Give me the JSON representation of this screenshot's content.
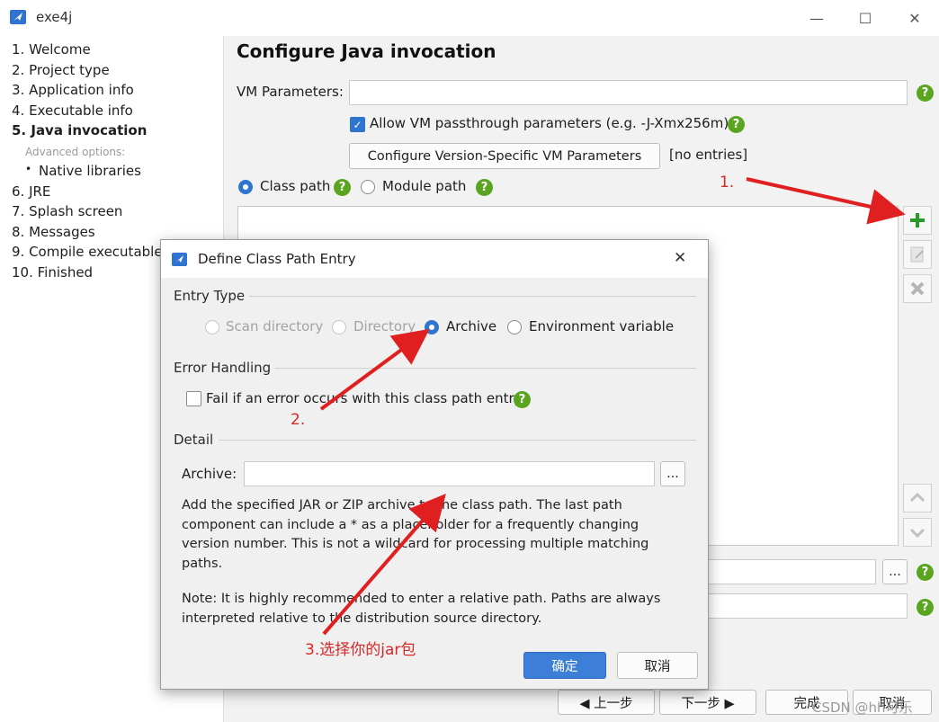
{
  "window": {
    "title": "exe4j",
    "minimize": "—",
    "maximize": "☐",
    "close": "✕"
  },
  "sidebar": {
    "items": [
      {
        "label": "1. Welcome"
      },
      {
        "label": "2. Project type"
      },
      {
        "label": "3. Application info"
      },
      {
        "label": "4. Executable info"
      },
      {
        "label": "5. Java invocation"
      },
      {
        "label": "Advanced options:"
      },
      {
        "label": "Native libraries"
      },
      {
        "label": "6. JRE"
      },
      {
        "label": "7. Splash screen"
      },
      {
        "label": "8. Messages"
      },
      {
        "label": "9. Compile executable"
      },
      {
        "label": "10. Finished"
      }
    ],
    "bullet": "•"
  },
  "main": {
    "title": "Configure Java invocation",
    "vm_params_label": "VM Parameters:",
    "vm_params_value": "",
    "passthrough_label": "Allow VM passthrough parameters (e.g. -J-Xmx256m)",
    "passthrough_checked": true,
    "configure_version_button": "Configure Version-Specific VM Parameters",
    "no_entries": "[no entries]",
    "class_path_label": "Class path",
    "module_path_label": "Module path",
    "help_glyph": "?",
    "ellipsis": "...",
    "nav": {
      "back": "◀  上一步",
      "next": "下一步  ▶",
      "finish": "完成",
      "cancel": "取消"
    }
  },
  "dialog": {
    "title": "Define Class Path Entry",
    "close": "✕",
    "entry_type_label": "Entry Type",
    "entry_types": [
      {
        "label": "Scan directory",
        "enabled": false,
        "selected": false
      },
      {
        "label": "Directory",
        "enabled": false,
        "selected": false
      },
      {
        "label": "Archive",
        "enabled": true,
        "selected": true
      },
      {
        "label": "Environment variable",
        "enabled": true,
        "selected": false
      }
    ],
    "error_handling_label": "Error Handling",
    "fail_label": "Fail if an error occurs with this class path entry",
    "fail_checked": false,
    "detail_label": "Detail",
    "archive_label": "Archive:",
    "archive_value": "",
    "browse": "...",
    "description": [
      "Add the specified JAR or ZIP archive to the class path. The last path",
      "component can include a * as a placeholder for a frequently changing",
      "version number. This is not a wildcard for processing multiple matching",
      "paths."
    ],
    "note": [
      "Note: It is highly recommended to enter a relative path. Paths are always",
      "interpreted relative to the distribution source directory."
    ],
    "ok": "确定",
    "cancel": "取消"
  },
  "annotations": {
    "step1": "1.",
    "step2": "2.",
    "step3": "3.选择你的jar包",
    "color": "#e02020"
  },
  "watermark": "CSDN @hh可乐",
  "colors": {
    "accent": "#2f74d0",
    "help": "#5aa520",
    "add": "#2a9a2a"
  }
}
